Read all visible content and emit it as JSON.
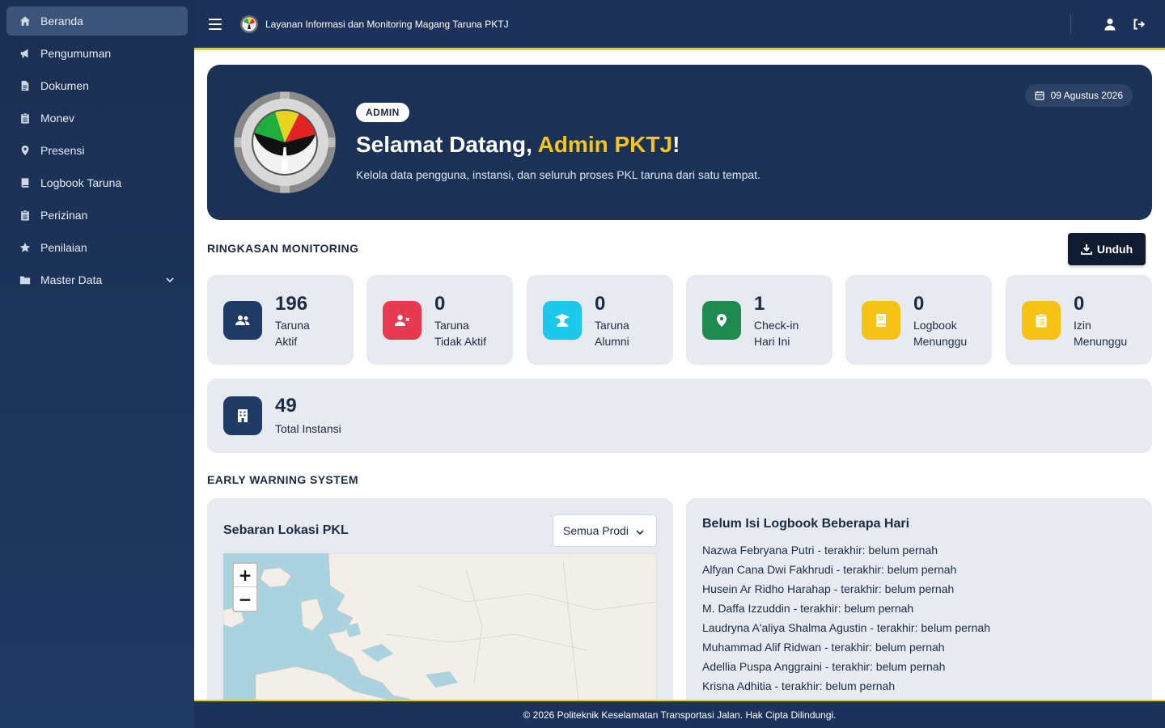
{
  "app": {
    "title": "Layanan Informasi dan Monitoring Magang Taruna PKTJ"
  },
  "sidebar": {
    "items": [
      {
        "label": "Beranda",
        "icon": "home-icon",
        "active": true
      },
      {
        "label": "Pengumuman",
        "icon": "megaphone-icon"
      },
      {
        "label": "Dokumen",
        "icon": "file-icon"
      },
      {
        "label": "Monev",
        "icon": "clipboard-icon"
      },
      {
        "label": "Presensi",
        "icon": "map-pin-icon"
      },
      {
        "label": "Logbook Taruna",
        "icon": "book-icon"
      },
      {
        "label": "Perizinan",
        "icon": "clipboard-list-icon"
      },
      {
        "label": "Penilaian",
        "icon": "star-icon"
      },
      {
        "label": "Master Data",
        "icon": "folder-icon",
        "expandable": true
      }
    ]
  },
  "hero": {
    "role": "ADMIN",
    "greeting": "Selamat Datang, ",
    "name": "Admin PKTJ",
    "exclaim": "!",
    "subtitle": "Kelola data pengguna, instansi, dan seluruh proses PKL taruna dari satu tempat.",
    "date": "09 Agustus 2026"
  },
  "summary": {
    "title": "RINGKASAN MONITORING",
    "download_label": "Unduh",
    "stats": [
      {
        "value": "196",
        "line1": "Taruna",
        "line2": "Aktif",
        "icon": "users-icon",
        "color": "#1f3a64"
      },
      {
        "value": "0",
        "line1": "Taruna",
        "line2": "Tidak Aktif",
        "icon": "user-x-icon",
        "color": "#e53a4f"
      },
      {
        "value": "0",
        "line1": "Taruna",
        "line2": "Alumni",
        "icon": "graduate-icon",
        "color": "#1cc8ec"
      },
      {
        "value": "1",
        "line1": "Check-in",
        "line2": "Hari Ini",
        "icon": "map-pin-icon",
        "color": "#1e8a4f"
      },
      {
        "value": "0",
        "line1": "Logbook",
        "line2": "Menunggu",
        "icon": "book-icon",
        "color": "#f7c216"
      },
      {
        "value": "0",
        "line1": "Izin",
        "line2": "Menunggu",
        "icon": "clipboard-list-icon",
        "color": "#f7c216"
      }
    ],
    "instansi": {
      "value": "49",
      "label": "Total Instansi",
      "icon": "building-icon",
      "color": "#1f3a64"
    }
  },
  "ews": {
    "title": "EARLY WARNING SYSTEM",
    "map": {
      "title": "Sebaran Lokasi PKL",
      "filter_value": "Semua Prodi",
      "zoom_in": "+",
      "zoom_out": "−"
    },
    "logbook": {
      "title": "Belum Isi Logbook Beberapa Hari",
      "items": [
        "Nazwa Febryana Putri - terakhir: belum pernah",
        "Alfyan Cana Dwi Fakhrudi - terakhir: belum pernah",
        "Husein Ar Ridho Harahap - terakhir: belum pernah",
        "M. Daffa Izzuddin - terakhir: belum pernah",
        "Laudryna A'aliya Shalma Agustin - terakhir: belum pernah",
        "Muhammad Alif Ridwan - terakhir: belum pernah",
        "Adellia Puspa Anggraini - terakhir: belum pernah",
        "Krisna Adhitia - terakhir: belum pernah"
      ]
    }
  },
  "footer": {
    "text": "© 2026 Politeknik Keselamatan Transportasi Jalan. Hak Cipta Dilindungi."
  }
}
